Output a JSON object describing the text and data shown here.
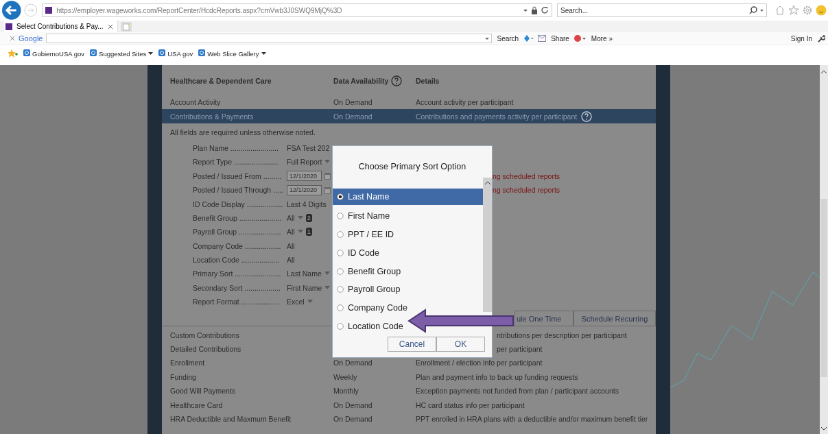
{
  "browser": {
    "url": "https://employer.wageworks.com/ReportCenter/HcdcReports.aspx?cmVwb3J0SWQ9MjQ%3D",
    "search_placeholder": "Search...",
    "tab_title": "Select Contributions & Pay...",
    "toolbar": {
      "google_label": "Google",
      "search_label": "Search",
      "share_label": "Share",
      "more_label": "More »",
      "sign_in": "Sign In"
    },
    "favorites": [
      {
        "label": "GobiernoUSA gov",
        "dropdown": false
      },
      {
        "label": "Suggested Sites",
        "dropdown": true
      },
      {
        "label": "USA gov",
        "dropdown": false
      },
      {
        "label": "Web Slice Gallery",
        "dropdown": true
      }
    ]
  },
  "report_table": {
    "headers": [
      {
        "label": "Healthcare & Dependent Care"
      },
      {
        "label": "Data Availability",
        "help": true
      },
      {
        "label": "Details"
      }
    ],
    "rows": [
      {
        "name": "Account Activity",
        "availability": "On Demand",
        "details": "Account activity per participant",
        "selected": false,
        "help": false
      },
      {
        "name": "Contributions & Payments",
        "availability": "On Demand",
        "details": "Contributions and payments activity per participant",
        "selected": true,
        "help": true
      }
    ]
  },
  "form": {
    "note": "All fields are required unless otherwise noted.",
    "fields": [
      {
        "label": "Plan Name ........................",
        "value": "FSA Test 202",
        "kind": "text"
      },
      {
        "label": "Report Type ......................",
        "value": "Full Report",
        "kind": "select"
      },
      {
        "label": "Posted / Issued From .........",
        "value": "12/1/2020",
        "kind": "date",
        "warning": "ng scheduled reports"
      },
      {
        "label": "Posted / Issued Through .....",
        "value": "12/1/2020",
        "kind": "date",
        "warning": "ng scheduled reports"
      },
      {
        "label": "ID Code Display ..................",
        "value": "Last 4 Digits",
        "kind": "text"
      },
      {
        "label": "Benefit Group .....................",
        "value": "All",
        "kind": "select",
        "badge": "2"
      },
      {
        "label": "Payroll Group .....................",
        "value": "All",
        "kind": "select",
        "badge": "1"
      },
      {
        "label": "Company Code ..................",
        "value": "All",
        "kind": "text"
      },
      {
        "label": "Location Code ...................",
        "value": "All",
        "kind": "text"
      },
      {
        "label": "Primary Sort .......................",
        "value": "Last Name",
        "kind": "select"
      },
      {
        "label": "Secondary Sort ..................",
        "value": "First Name",
        "kind": "select"
      },
      {
        "label": "Report Format ...................",
        "value": "Excel",
        "kind": "select"
      }
    ],
    "buttons": [
      "ule One Time",
      "Schedule Recurring"
    ]
  },
  "more_reports": [
    {
      "name": "Custom Contributions",
      "details": "ntributions per description per participant",
      "cut": true
    },
    {
      "name": "Detailed Contributions",
      "details": "per participant",
      "cut": true
    },
    {
      "name": "Enrollment",
      "availability": "On Demand",
      "details": "Enrollment / election info per participant"
    },
    {
      "name": "Funding",
      "availability": "Weekly",
      "details": "Plan and payment info to back up funding requests"
    },
    {
      "name": "Good Will Payments",
      "availability": "Monthly",
      "details": "Exception payments not funded from plan / participant accounts"
    },
    {
      "name": "Healthcare Card",
      "availability": "On Demand",
      "details": "HC card status info per participant"
    },
    {
      "name": "HRA Deductible and Maxmum Benefit",
      "availability": "On Demand",
      "details": "PPT enrolled in HRA plans with a deductible and/or maximum benefit tier"
    }
  ],
  "dialog": {
    "title": "Choose Primary Sort Option",
    "options": [
      {
        "label": "Last Name",
        "selected": true
      },
      {
        "label": "First Name",
        "selected": false
      },
      {
        "label": "PPT / EE ID",
        "selected": false
      },
      {
        "label": "ID Code",
        "selected": false
      },
      {
        "label": "Benefit Group",
        "selected": false
      },
      {
        "label": "Payroll Group",
        "selected": false
      },
      {
        "label": "Company Code",
        "selected": false
      },
      {
        "label": "Location Code",
        "selected": false
      }
    ],
    "buttons": [
      "Cancel",
      "OK"
    ]
  }
}
